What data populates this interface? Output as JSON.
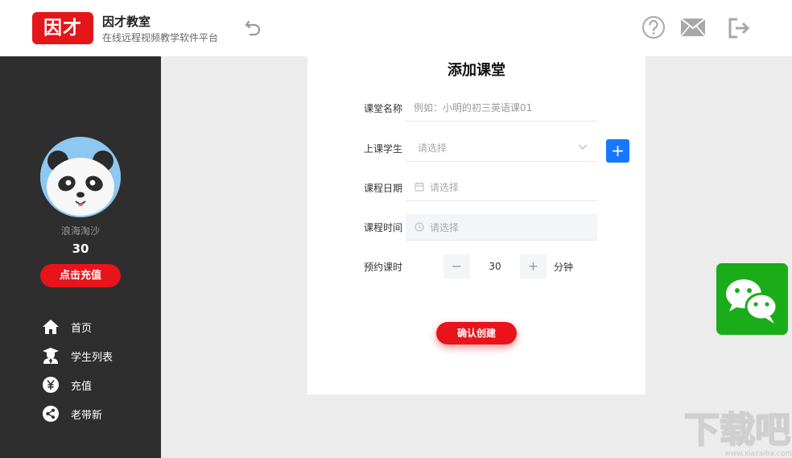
{
  "header": {
    "logo_text": "因才",
    "title": "因才教室",
    "subtitle": "在线远程视频教学软件平台",
    "icons": [
      "undo-icon",
      "help-icon",
      "mail-icon",
      "exit-icon"
    ]
  },
  "sidebar": {
    "user_name": "浪海淘沙",
    "balance": "30",
    "recharge_label": "点击充值",
    "items": [
      {
        "label": "首页",
        "icon": "home-icon"
      },
      {
        "label": "学生列表",
        "icon": "student-icon"
      },
      {
        "label": "充值",
        "icon": "yuan-icon"
      },
      {
        "label": "老带新",
        "icon": "share-icon"
      }
    ]
  },
  "form": {
    "title": "添加课堂",
    "name_label": "课堂名称",
    "name_placeholder": "例如：小明的初三英语课01",
    "students_label": "上课学生",
    "students_placeholder": "请选择",
    "add_student_symbol": "+",
    "date_label": "课程日期",
    "date_placeholder": "请选择",
    "time_label": "课程时间",
    "time_placeholder": "请选择",
    "duration_label": "预约课时",
    "duration_minus": "−",
    "duration_value": "30",
    "duration_plus": "+",
    "duration_unit": "分钟",
    "confirm_label": "确认创建"
  },
  "watermark": {
    "text": "下载吧",
    "url": "www.xiazaiba.com"
  },
  "colors": {
    "brand_red": "#e8131b",
    "sidebar_bg": "#2e2e2e",
    "primary_blue": "#1677ff",
    "wechat_green": "#1aad19"
  }
}
